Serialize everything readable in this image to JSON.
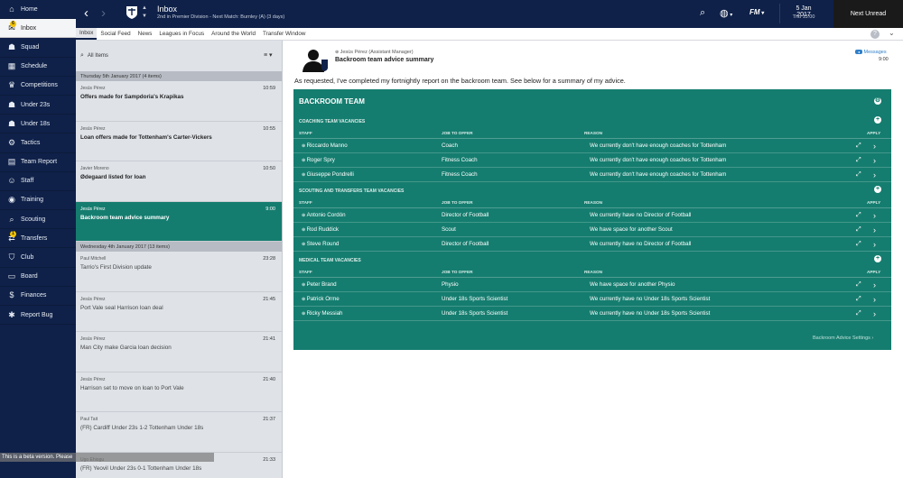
{
  "sidebar": {
    "items": [
      {
        "label": "Home",
        "icon": "home-icon",
        "glyph": "⌂",
        "active": false
      },
      {
        "label": "Inbox",
        "icon": "inbox-icon",
        "glyph": "✉",
        "active": true,
        "badge": "6"
      },
      {
        "label": "Squad",
        "icon": "squad-icon",
        "glyph": "☗",
        "active": false
      },
      {
        "label": "Schedule",
        "icon": "schedule-icon",
        "glyph": "▦",
        "active": false
      },
      {
        "label": "Competitions",
        "icon": "trophy-icon",
        "glyph": "♛",
        "active": false
      },
      {
        "label": "Under 23s",
        "icon": "under23-icon",
        "glyph": "☗",
        "active": false
      },
      {
        "label": "Under 18s",
        "icon": "under18-icon",
        "glyph": "☗",
        "active": false
      },
      {
        "label": "Tactics",
        "icon": "tactics-icon",
        "glyph": "⚙",
        "active": false
      },
      {
        "label": "Team Report",
        "icon": "report-icon",
        "glyph": "▤",
        "active": false
      },
      {
        "label": "Staff",
        "icon": "staff-icon",
        "glyph": "☺",
        "active": false
      },
      {
        "label": "Training",
        "icon": "training-icon",
        "glyph": "◉",
        "active": false
      },
      {
        "label": "Scouting",
        "icon": "scouting-icon",
        "glyph": "⌕",
        "active": false
      },
      {
        "label": "Transfers",
        "icon": "transfers-icon",
        "glyph": "⇄",
        "active": false,
        "badge": "1"
      },
      {
        "label": "Club",
        "icon": "club-icon",
        "glyph": "⛉",
        "active": false
      },
      {
        "label": "Board",
        "icon": "board-icon",
        "glyph": "▭",
        "active": false
      },
      {
        "label": "Finances",
        "icon": "finances-icon",
        "glyph": "$",
        "active": false
      },
      {
        "label": "Report Bug",
        "icon": "bug-icon",
        "glyph": "✱",
        "active": false
      }
    ]
  },
  "header": {
    "title": "Inbox",
    "subtitle": "2nd in Premier Division - Next Match: Burnley (A) (3 days)",
    "fm_logo": "FM",
    "date": "5 Jan 2017",
    "time": "Thu 13:00",
    "next_unread": "Next Unread"
  },
  "subtabs": [
    "Inbox",
    "Social Feed",
    "News",
    "Leagues in Focus",
    "Around the World",
    "Transfer Window"
  ],
  "help": "?",
  "list": {
    "search_placeholder": "All Items",
    "groups": [
      {
        "date": "Thursday 5th January 2017 (4 items)",
        "messages": [
          {
            "sender": "Jesús Pérez",
            "subject": "Offers made for Sampdoria's Krapikas",
            "time": "10:59",
            "read": false,
            "selected": false
          },
          {
            "sender": "Jesús Pérez",
            "subject": "Loan offers made for Tottenham's Carter-Vickers",
            "time": "10:55",
            "read": false,
            "selected": false
          },
          {
            "sender": "Javier Moreno",
            "subject": "Ødegaard listed for loan",
            "time": "10:50",
            "read": false,
            "selected": false
          },
          {
            "sender": "Jesús Pérez",
            "subject": "Backroom team advice summary",
            "time": "9:00",
            "read": false,
            "selected": true
          }
        ]
      },
      {
        "date": "Wednesday 4th January 2017 (13 items)",
        "messages": [
          {
            "sender": "Paul Mitchell",
            "subject": "Tarrio's First Division update",
            "time": "23:28",
            "read": true,
            "selected": false
          },
          {
            "sender": "Jesús Pérez",
            "subject": "Port Vale seal Harrison loan deal",
            "time": "21:45",
            "read": true,
            "selected": false
          },
          {
            "sender": "Jesús Pérez",
            "subject": "Man City make Garcia loan decision",
            "time": "21:41",
            "read": true,
            "selected": false
          },
          {
            "sender": "Jesús Pérez",
            "subject": "Harrison set to move on loan to Port Vale",
            "time": "21:40",
            "read": true,
            "selected": false
          },
          {
            "sender": "Paul Tait",
            "subject": "(FR) Cardiff Under 23s 1-2 Tottenham Under 18s",
            "time": "21:37",
            "read": true,
            "selected": false
          },
          {
            "sender": "Ugo Ehiogu",
            "subject": "(FR) Yeovil Under 23s 0-1 Tottenham Under 18s",
            "time": "21:33",
            "read": true,
            "selected": false
          }
        ]
      }
    ],
    "beta_notice": "This is a beta version. Please"
  },
  "message": {
    "from": "Jesús Pérez  (Assistant Manager)",
    "title": "Backroom team advice summary",
    "link": "Messages",
    "time": "9:00",
    "intro": "As requested, I've completed my fortnightly report on the backroom team. See below for a summary of my advice."
  },
  "panel": {
    "title": "BACKROOM TEAM",
    "columns": {
      "staff": "STAFF",
      "job": "JOB TO OFFER",
      "reason": "REASON",
      "apply": "APPLY"
    },
    "sections": [
      {
        "title": "COACHING TEAM VACANCIES",
        "rows": [
          {
            "staff": "Riccardo Manno",
            "job": "Coach",
            "reason": "We currently don't have enough coaches for Tottenham"
          },
          {
            "staff": "Roger Spry",
            "job": "Fitness Coach",
            "reason": "We currently don't have enough coaches for Tottenham"
          },
          {
            "staff": "Giuseppe Pondrelli",
            "job": "Fitness Coach",
            "reason": "We currently don't have enough coaches for Tottenham"
          }
        ]
      },
      {
        "title": "SCOUTING AND TRANSFERS TEAM VACANCIES",
        "rows": [
          {
            "staff": "Antonio Cordón",
            "job": "Director of Football",
            "reason": "We currently have no Director of Football"
          },
          {
            "staff": "Rod Ruddick",
            "job": "Scout",
            "reason": "We have space for another Scout"
          },
          {
            "staff": "Steve Round",
            "job": "Director of Football",
            "reason": "We currently have no Director of Football"
          }
        ]
      },
      {
        "title": "MEDICAL TEAM VACANCIES",
        "rows": [
          {
            "staff": "Peter Brand",
            "job": "Physio",
            "reason": "We have space for another Physio"
          },
          {
            "staff": "Patrick Orme",
            "job": "Under 18s Sports Scientist",
            "reason": "We currently have no Under 18s Sports Scientist"
          },
          {
            "staff": "Ricky Messiah",
            "job": "Under 18s Sports Scientist",
            "reason": "We currently have no Under 18s Sports Scientist"
          }
        ]
      }
    ],
    "settings_link": "Backroom Advice Settings  ›"
  },
  "colors": {
    "navy": "#0f2149",
    "teal": "#157d6f",
    "badge": "#f2c200"
  }
}
